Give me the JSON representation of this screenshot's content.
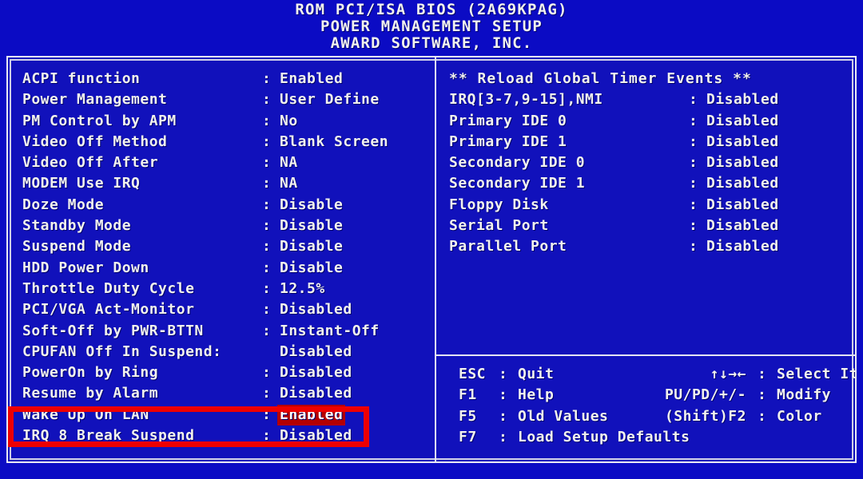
{
  "header": {
    "line1": "ROM PCI/ISA BIOS (2A69KPAG)",
    "line2": "POWER MANAGEMENT SETUP",
    "line3": "AWARD SOFTWARE, INC."
  },
  "separator": ":",
  "left_column": [
    {
      "label": "ACPI function",
      "value": "Enabled"
    },
    {
      "label": "Power Management",
      "value": "User Define"
    },
    {
      "label": "PM Control by APM",
      "value": "No"
    },
    {
      "label": "Video Off Method",
      "value": "Blank Screen"
    },
    {
      "label": "Video Off After",
      "value": "NA"
    },
    {
      "label": "MODEM Use IRQ",
      "value": "NA"
    },
    {
      "label": "Doze Mode",
      "value": "Disable"
    },
    {
      "label": "Standby Mode",
      "value": "Disable"
    },
    {
      "label": "Suspend Mode",
      "value": "Disable"
    },
    {
      "label": "HDD Power Down",
      "value": "Disable"
    },
    {
      "label": "Throttle Duty Cycle",
      "value": "12.5%"
    },
    {
      "label": "PCI/VGA Act-Monitor",
      "value": "Disabled"
    },
    {
      "label": "Soft-Off by PWR-BTTN",
      "value": "Instant-Off"
    },
    {
      "label": "CPUFAN Off In Suspend:",
      "value": "Disabled",
      "no_colon": true
    },
    {
      "label": "PowerOn by Ring",
      "value": "Disabled"
    },
    {
      "label": "Resume by Alarm",
      "value": "Disabled"
    },
    {
      "label": "Wake Up On LAN",
      "value": "Enabled",
      "selected": true
    },
    {
      "label": "IRQ 8 Break Suspend",
      "value": "Disabled"
    }
  ],
  "right_column": {
    "heading": "** Reload Global Timer Events **",
    "items": [
      {
        "label": "IRQ[3-7,9-15],NMI",
        "value": "Disabled"
      },
      {
        "label": "Primary IDE 0",
        "value": "Disabled"
      },
      {
        "label": "Primary IDE 1",
        "value": "Disabled"
      },
      {
        "label": "Secondary IDE 0",
        "value": "Disabled"
      },
      {
        "label": "Secondary IDE 1",
        "value": "Disabled"
      },
      {
        "label": "Floppy Disk",
        "value": "Disabled"
      },
      {
        "label": "Serial Port",
        "value": "Disabled"
      },
      {
        "label": "Parallel Port",
        "value": "Disabled"
      }
    ]
  },
  "legend": [
    {
      "left_key": "ESC",
      "left_desc": "Quit",
      "right_key": "↑↓→←",
      "right_desc": "Select Item"
    },
    {
      "left_key": "F1",
      "left_desc": "Help",
      "right_key": "PU/PD/+/-",
      "right_desc": "Modify"
    },
    {
      "left_key": "F5",
      "left_desc": "Old Values",
      "right_key": "(Shift)F2",
      "right_desc": "Color"
    },
    {
      "left_key": "F7",
      "left_desc": "Load Setup Defaults",
      "right_key": "",
      "right_desc": ""
    }
  ],
  "colors": {
    "background": "#0000cc",
    "panel": "#1111bb",
    "text": "#f2f2ee",
    "border": "#e8e8f4",
    "selected_value_bg": "#b40000",
    "annotation": "#ee0000"
  }
}
